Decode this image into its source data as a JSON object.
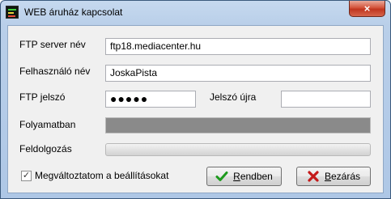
{
  "window": {
    "title": "WEB áruház kapcsolat",
    "close_glyph": "×"
  },
  "form": {
    "ftp_server": {
      "label": "FTP server név",
      "value": "ftp18.mediacenter.hu"
    },
    "username": {
      "label": "Felhasználó név",
      "value": "JoskaPista"
    },
    "ftp_password": {
      "label": "FTP jelszó",
      "value": "●●●●●"
    },
    "password_again": {
      "label": "Jelszó újra",
      "value": ""
    },
    "in_progress": {
      "label": "Folyamatban"
    },
    "processing": {
      "label": "Feldolgozás"
    },
    "remember": {
      "label": "Megváltoztatom a beállításokat",
      "checked": true,
      "check_glyph": "✓"
    }
  },
  "buttons": {
    "ok": {
      "label_first": "R",
      "label_rest": "endben",
      "icon": "green-check-icon"
    },
    "close": {
      "label_first": "B",
      "label_rest": "ezárás",
      "icon": "red-x-icon"
    }
  }
}
